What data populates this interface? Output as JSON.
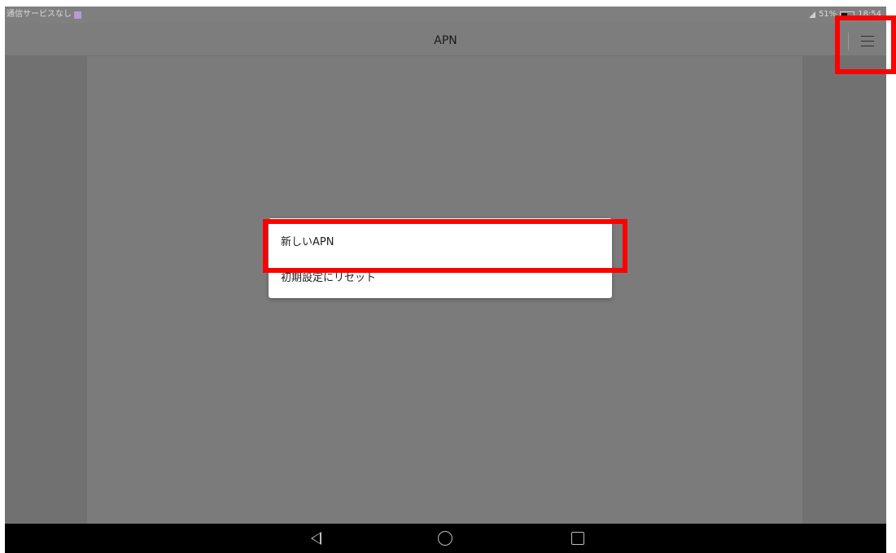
{
  "status_bar": {
    "carrier": "通信サービスなし",
    "battery_percent": "51%",
    "time": "18:54",
    "icons": [
      "sim-icon",
      "signal-icon",
      "battery-icon"
    ]
  },
  "action_bar": {
    "title": "APN",
    "menu_icon": "hamburger-menu-icon"
  },
  "popup_menu": {
    "items": [
      {
        "label": "新しいAPN"
      },
      {
        "label": "初期設定にリセット"
      }
    ]
  },
  "nav_bar": {
    "icons": [
      "back-icon",
      "home-icon",
      "recent-apps-icon"
    ]
  },
  "highlight_color": "#ff0000"
}
